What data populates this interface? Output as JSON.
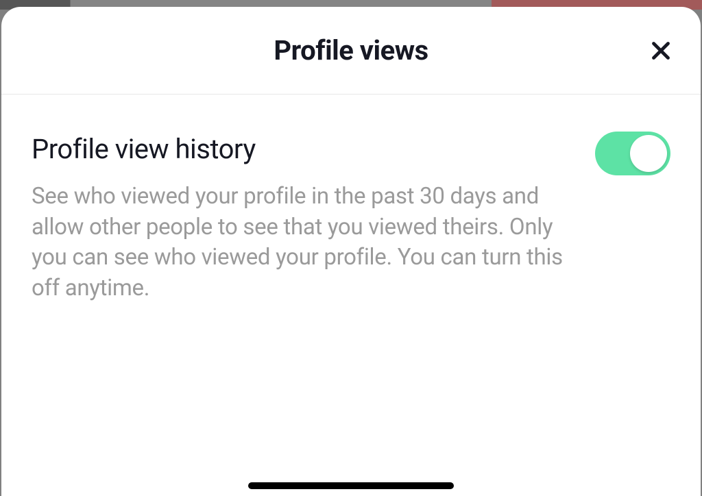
{
  "modal": {
    "title": "Profile views"
  },
  "setting": {
    "title": "Profile view history",
    "description": "See who viewed your profile in the past 30 days and allow other people to see that you viewed theirs. Only you can see who viewed your profile. You can turn this off anytime.",
    "enabled": true
  }
}
